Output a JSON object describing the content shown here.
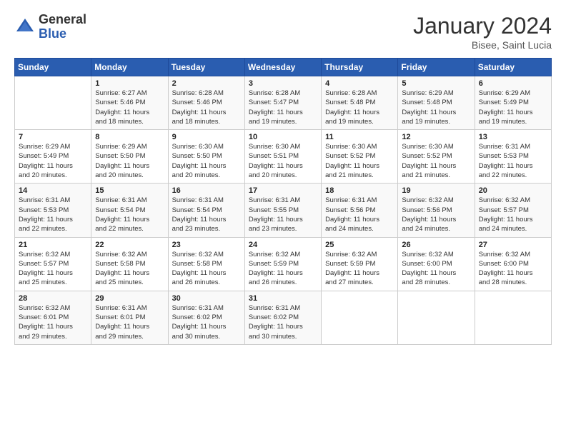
{
  "header": {
    "logo_general": "General",
    "logo_blue": "Blue",
    "month_year": "January 2024",
    "location": "Bisee, Saint Lucia"
  },
  "weekdays": [
    "Sunday",
    "Monday",
    "Tuesday",
    "Wednesday",
    "Thursday",
    "Friday",
    "Saturday"
  ],
  "weeks": [
    [
      {
        "day": "",
        "info": ""
      },
      {
        "day": "1",
        "info": "Sunrise: 6:27 AM\nSunset: 5:46 PM\nDaylight: 11 hours\nand 18 minutes."
      },
      {
        "day": "2",
        "info": "Sunrise: 6:28 AM\nSunset: 5:46 PM\nDaylight: 11 hours\nand 18 minutes."
      },
      {
        "day": "3",
        "info": "Sunrise: 6:28 AM\nSunset: 5:47 PM\nDaylight: 11 hours\nand 19 minutes."
      },
      {
        "day": "4",
        "info": "Sunrise: 6:28 AM\nSunset: 5:48 PM\nDaylight: 11 hours\nand 19 minutes."
      },
      {
        "day": "5",
        "info": "Sunrise: 6:29 AM\nSunset: 5:48 PM\nDaylight: 11 hours\nand 19 minutes."
      },
      {
        "day": "6",
        "info": "Sunrise: 6:29 AM\nSunset: 5:49 PM\nDaylight: 11 hours\nand 19 minutes."
      }
    ],
    [
      {
        "day": "7",
        "info": "Sunrise: 6:29 AM\nSunset: 5:49 PM\nDaylight: 11 hours\nand 20 minutes."
      },
      {
        "day": "8",
        "info": "Sunrise: 6:29 AM\nSunset: 5:50 PM\nDaylight: 11 hours\nand 20 minutes."
      },
      {
        "day": "9",
        "info": "Sunrise: 6:30 AM\nSunset: 5:50 PM\nDaylight: 11 hours\nand 20 minutes."
      },
      {
        "day": "10",
        "info": "Sunrise: 6:30 AM\nSunset: 5:51 PM\nDaylight: 11 hours\nand 20 minutes."
      },
      {
        "day": "11",
        "info": "Sunrise: 6:30 AM\nSunset: 5:52 PM\nDaylight: 11 hours\nand 21 minutes."
      },
      {
        "day": "12",
        "info": "Sunrise: 6:30 AM\nSunset: 5:52 PM\nDaylight: 11 hours\nand 21 minutes."
      },
      {
        "day": "13",
        "info": "Sunrise: 6:31 AM\nSunset: 5:53 PM\nDaylight: 11 hours\nand 22 minutes."
      }
    ],
    [
      {
        "day": "14",
        "info": "Sunrise: 6:31 AM\nSunset: 5:53 PM\nDaylight: 11 hours\nand 22 minutes."
      },
      {
        "day": "15",
        "info": "Sunrise: 6:31 AM\nSunset: 5:54 PM\nDaylight: 11 hours\nand 22 minutes."
      },
      {
        "day": "16",
        "info": "Sunrise: 6:31 AM\nSunset: 5:54 PM\nDaylight: 11 hours\nand 23 minutes."
      },
      {
        "day": "17",
        "info": "Sunrise: 6:31 AM\nSunset: 5:55 PM\nDaylight: 11 hours\nand 23 minutes."
      },
      {
        "day": "18",
        "info": "Sunrise: 6:31 AM\nSunset: 5:56 PM\nDaylight: 11 hours\nand 24 minutes."
      },
      {
        "day": "19",
        "info": "Sunrise: 6:32 AM\nSunset: 5:56 PM\nDaylight: 11 hours\nand 24 minutes."
      },
      {
        "day": "20",
        "info": "Sunrise: 6:32 AM\nSunset: 5:57 PM\nDaylight: 11 hours\nand 24 minutes."
      }
    ],
    [
      {
        "day": "21",
        "info": "Sunrise: 6:32 AM\nSunset: 5:57 PM\nDaylight: 11 hours\nand 25 minutes."
      },
      {
        "day": "22",
        "info": "Sunrise: 6:32 AM\nSunset: 5:58 PM\nDaylight: 11 hours\nand 25 minutes."
      },
      {
        "day": "23",
        "info": "Sunrise: 6:32 AM\nSunset: 5:58 PM\nDaylight: 11 hours\nand 26 minutes."
      },
      {
        "day": "24",
        "info": "Sunrise: 6:32 AM\nSunset: 5:59 PM\nDaylight: 11 hours\nand 26 minutes."
      },
      {
        "day": "25",
        "info": "Sunrise: 6:32 AM\nSunset: 5:59 PM\nDaylight: 11 hours\nand 27 minutes."
      },
      {
        "day": "26",
        "info": "Sunrise: 6:32 AM\nSunset: 6:00 PM\nDaylight: 11 hours\nand 28 minutes."
      },
      {
        "day": "27",
        "info": "Sunrise: 6:32 AM\nSunset: 6:00 PM\nDaylight: 11 hours\nand 28 minutes."
      }
    ],
    [
      {
        "day": "28",
        "info": "Sunrise: 6:32 AM\nSunset: 6:01 PM\nDaylight: 11 hours\nand 29 minutes."
      },
      {
        "day": "29",
        "info": "Sunrise: 6:31 AM\nSunset: 6:01 PM\nDaylight: 11 hours\nand 29 minutes."
      },
      {
        "day": "30",
        "info": "Sunrise: 6:31 AM\nSunset: 6:02 PM\nDaylight: 11 hours\nand 30 minutes."
      },
      {
        "day": "31",
        "info": "Sunrise: 6:31 AM\nSunset: 6:02 PM\nDaylight: 11 hours\nand 30 minutes."
      },
      {
        "day": "",
        "info": ""
      },
      {
        "day": "",
        "info": ""
      },
      {
        "day": "",
        "info": ""
      }
    ]
  ]
}
